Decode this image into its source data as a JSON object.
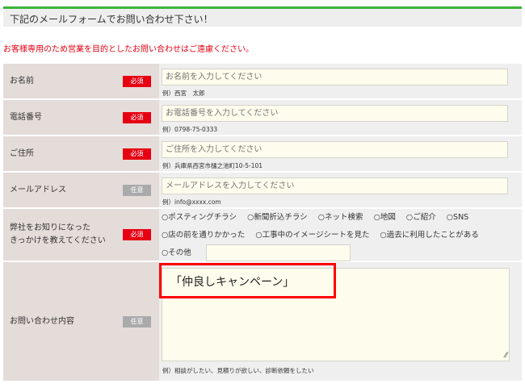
{
  "header": {
    "title": "下記のメールフォームでお問い合わせ下さい！"
  },
  "notice": "お客様専用のため営業を目的としたお問い合わせはご遠慮ください。",
  "badges": {
    "required": "必須",
    "optional": "任意"
  },
  "fields": [
    {
      "label": "お名前",
      "placeholder": "お名前を入力してください",
      "example": "例）西宮　太郎"
    },
    {
      "label": "電話番号",
      "placeholder": "お電話番号を入力してください",
      "example": "例）0798-75-0333"
    },
    {
      "label": "ご住所",
      "placeholder": "ご住所を入力してください",
      "example": "例）兵庫県西宮市樋之池町10-5-101"
    },
    {
      "label": "メールアドレス",
      "placeholder": "メールアドレスを入力してください",
      "example": "例）info@xxxx.com"
    }
  ],
  "source": {
    "label_line1": "弊社をお知りになった",
    "label_line2": "きっかけを教えてください",
    "options": [
      "ポスティングチラシ",
      "新聞折込チラシ",
      "ネット検索",
      "地図",
      "ご紹介",
      "SNS",
      "店の前を通りかかった",
      "工事中のイメージシートを見た",
      "過去に利用したことがある",
      "その他"
    ]
  },
  "content": {
    "label": "お問い合わせ内容",
    "value": "「仲良しキャンペーン」",
    "example": "例）相談がしたい、見積りが欲しい、診断依頼をしたい"
  }
}
